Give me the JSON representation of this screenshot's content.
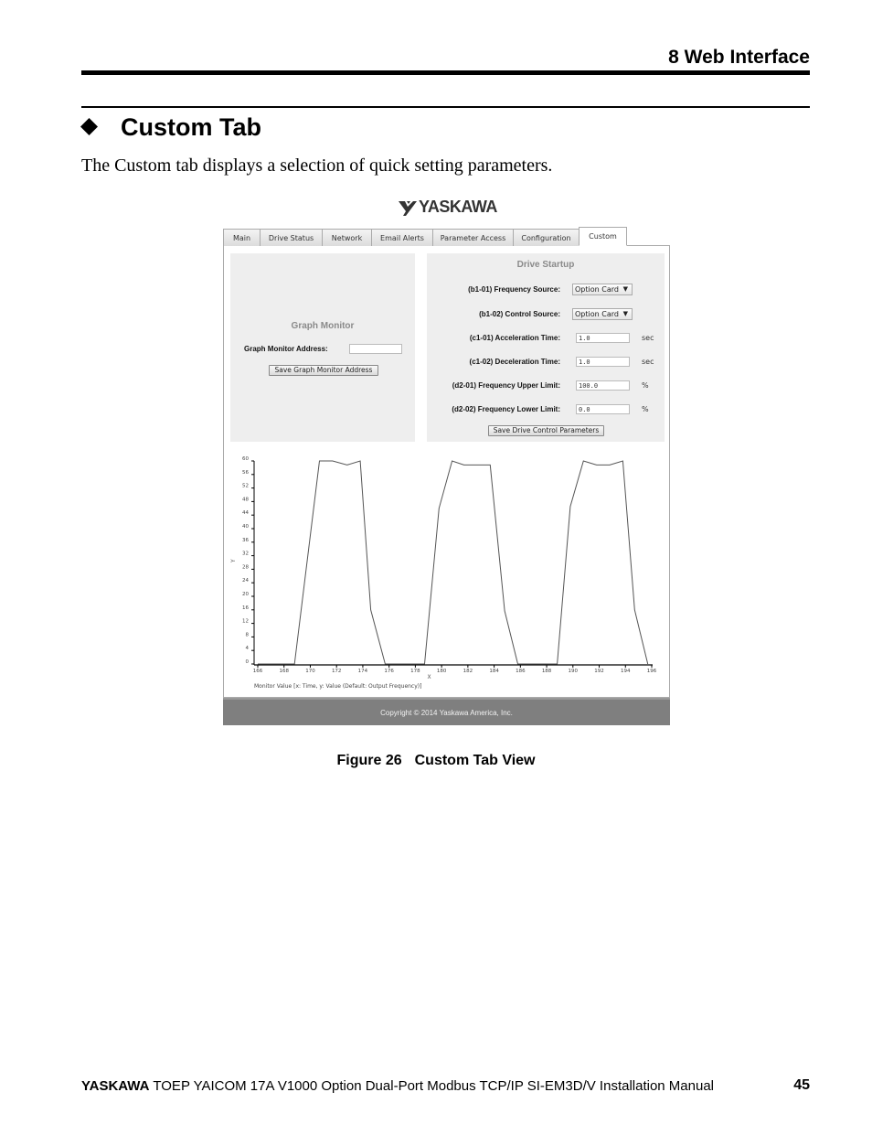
{
  "document": {
    "section_header": "8  Web Interface",
    "heading": "Custom Tab",
    "intro": "The Custom tab displays a selection of quick setting parameters.",
    "figure_caption_number": "Figure 26",
    "figure_caption_title": "Custom Tab View",
    "footer_brand": "YASKAWA",
    "footer_text": "TOEP YAICOM 17A V1000 Option Dual-Port Modbus TCP/IP SI-EM3D/V Installation Manual",
    "page_number": "45"
  },
  "app": {
    "logo_text": "YASKAWA",
    "tabs": [
      {
        "label": "Main",
        "active": false
      },
      {
        "label": "Drive Status",
        "active": false
      },
      {
        "label": "Network",
        "active": false
      },
      {
        "label": "Email Alerts",
        "active": false
      },
      {
        "label": "Parameter Access",
        "active": false
      },
      {
        "label": "Configuration",
        "active": false
      },
      {
        "label": "Custom",
        "active": true
      }
    ],
    "graph_monitor": {
      "title": "Graph Monitor",
      "address_label": "Graph Monitor Address:",
      "address_value": "",
      "save_button": "Save Graph Monitor Address"
    },
    "drive_startup": {
      "title": "Drive Startup",
      "fields": [
        {
          "label": "(b1-01) Frequency Source:",
          "type": "select",
          "value": "Option Card",
          "unit": ""
        },
        {
          "label": "(b1-02) Control Source:",
          "type": "select",
          "value": "Option Card",
          "unit": ""
        },
        {
          "label": "(c1-01) Acceleration Time:",
          "type": "input",
          "value": "1.0",
          "unit": "sec"
        },
        {
          "label": "(c1-02) Deceleration Time:",
          "type": "input",
          "value": "1.0",
          "unit": "sec"
        },
        {
          "label": "(d2-01) Frequency Upper Limit:",
          "type": "input",
          "value": "100.0",
          "unit": "%"
        },
        {
          "label": "(d2-02) Frequency Lower Limit:",
          "type": "input",
          "value": "0.0",
          "unit": "%"
        }
      ],
      "save_button": "Save Drive Control Parameters"
    },
    "copyright": "Copyright © 2014 Yaskawa America, Inc."
  },
  "chart_data": {
    "type": "line",
    "title": "",
    "xlabel": "X",
    "ylabel": "Y",
    "legend": "Monitor Value [x: Time, y: Value (Default: Output Frequency)]",
    "legend_placement": "bottom-left",
    "xlim": [
      166,
      196
    ],
    "ylim": [
      0,
      60
    ],
    "xticks": [
      166,
      168,
      170,
      172,
      174,
      176,
      178,
      180,
      182,
      184,
      186,
      188,
      190,
      192,
      194,
      196
    ],
    "yticks": [
      0,
      4,
      8,
      12,
      16,
      20,
      24,
      28,
      32,
      36,
      40,
      44,
      48,
      52,
      56,
      60
    ],
    "grid": false,
    "series": [
      {
        "name": "Monitor Value",
        "x": [
          166,
          168.8,
          170.7,
          171.7,
          172.8,
          173.8,
          174.6,
          175.7,
          178.7,
          179.8,
          180.8,
          181.7,
          183.7,
          184.8,
          185.8,
          188.8,
          189.8,
          190.8,
          191.8,
          192.8,
          193.8,
          194.7,
          195.7
        ],
        "y": [
          0,
          0,
          60,
          60,
          58.8,
          60,
          16,
          0,
          0,
          46,
          60,
          58.8,
          58.8,
          15.7,
          0,
          0,
          46.5,
          60,
          58.8,
          58.8,
          60,
          16,
          0
        ]
      }
    ]
  }
}
